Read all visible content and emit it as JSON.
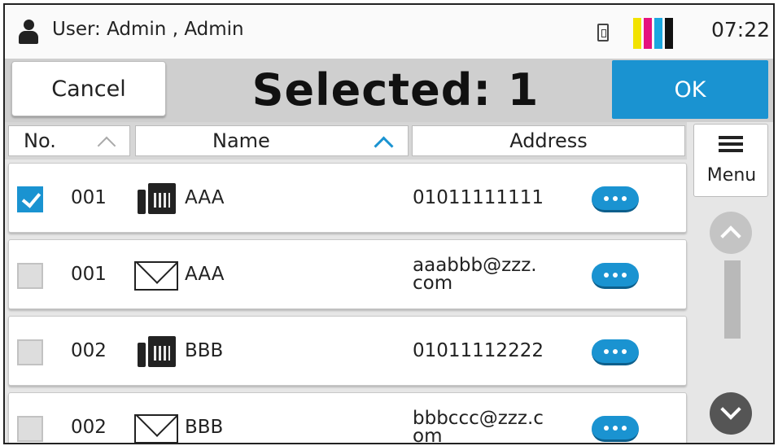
{
  "status": {
    "user_text": "User: Admin , Admin",
    "time": "07:22",
    "toner_colors": [
      "#f2e200",
      "#e5127e",
      "#1ba7e0",
      "#111111"
    ]
  },
  "header": {
    "cancel_label": "Cancel",
    "title": "Selected: 1",
    "ok_label": "OK"
  },
  "columns": {
    "no": "No.",
    "name": "Name",
    "address": "Address"
  },
  "menu": {
    "label": "Menu"
  },
  "rows": [
    {
      "checked": true,
      "num": "001",
      "type": "fax",
      "name": "AAA",
      "address": "01011111111"
    },
    {
      "checked": false,
      "num": "001",
      "type": "email",
      "name": "AAA",
      "address": "aaabbb@zzz.\ncom"
    },
    {
      "checked": false,
      "num": "002",
      "type": "fax",
      "name": "BBB",
      "address": "01011112222"
    },
    {
      "checked": false,
      "num": "002",
      "type": "email",
      "name": "BBB",
      "address": "bbbccc@zzz.c\nom"
    }
  ],
  "accent_color": "#1a93d1"
}
